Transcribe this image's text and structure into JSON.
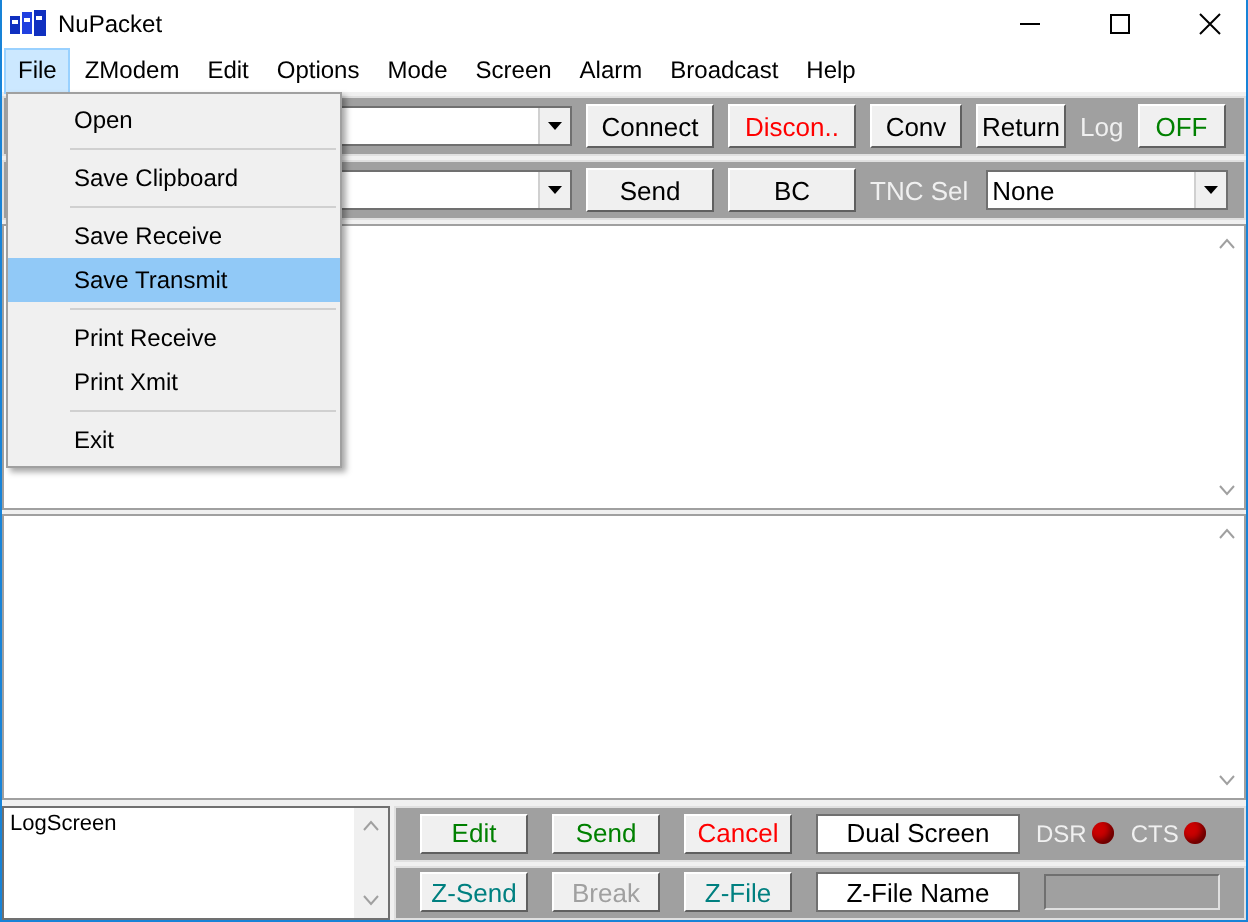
{
  "window": {
    "title": "NuPacket"
  },
  "menu_bar": [
    {
      "label": "File",
      "selected": true
    },
    {
      "label": "ZModem",
      "selected": false
    },
    {
      "label": "Edit",
      "selected": false
    },
    {
      "label": "Options",
      "selected": false
    },
    {
      "label": "Mode",
      "selected": false
    },
    {
      "label": "Screen",
      "selected": false
    },
    {
      "label": "Alarm",
      "selected": false
    },
    {
      "label": "Broadcast",
      "selected": false
    },
    {
      "label": "Help",
      "selected": false
    }
  ],
  "file_menu": {
    "groups": [
      [
        {
          "label": "Open",
          "selected": false
        }
      ],
      [
        {
          "label": "Save Clipboard",
          "selected": false
        }
      ],
      [
        {
          "label": "Save Receive",
          "selected": false
        },
        {
          "label": "Save Transmit",
          "selected": true
        }
      ],
      [
        {
          "label": "Print Receive",
          "selected": false
        },
        {
          "label": "Print Xmit",
          "selected": false
        }
      ],
      [
        {
          "label": "Exit",
          "selected": false
        }
      ]
    ]
  },
  "toolbar_1": {
    "buttons": [
      {
        "label": "Connect",
        "color": "#000000"
      },
      {
        "label": "Discon..",
        "color": "#ff0000"
      },
      {
        "label": "Conv",
        "color": "#000000"
      },
      {
        "label": "Return",
        "color": "#000000"
      }
    ],
    "log_label": "Log",
    "log_button": {
      "label": "OFF",
      "color": "#008000"
    }
  },
  "toolbar_2": {
    "buttons": [
      {
        "label": "Send",
        "color": "#000000"
      },
      {
        "label": "BC",
        "color": "#000000"
      }
    ],
    "tnc_label": "TNC Sel",
    "tnc_select": {
      "value": "None"
    }
  },
  "log_screen": {
    "value": "LogScreen"
  },
  "bottom_row_1": {
    "buttons": [
      {
        "label": "Edit",
        "color": "#008000",
        "disabled": false
      },
      {
        "label": "Send",
        "color": "#008000",
        "disabled": false
      },
      {
        "label": "Cancel",
        "color": "#ff0000",
        "disabled": false
      }
    ],
    "field": "Dual Screen",
    "indicators": [
      {
        "label": "DSR",
        "color": "#cc0000"
      },
      {
        "label": "CTS",
        "color": "#cc0000"
      }
    ]
  },
  "bottom_row_2": {
    "buttons": [
      {
        "label": "Z-Send",
        "color": "#008080",
        "disabled": false
      },
      {
        "label": "Break",
        "disabled": true
      },
      {
        "label": "Z-File",
        "color": "#008080",
        "disabled": false
      }
    ],
    "field": "Z-File Name"
  }
}
